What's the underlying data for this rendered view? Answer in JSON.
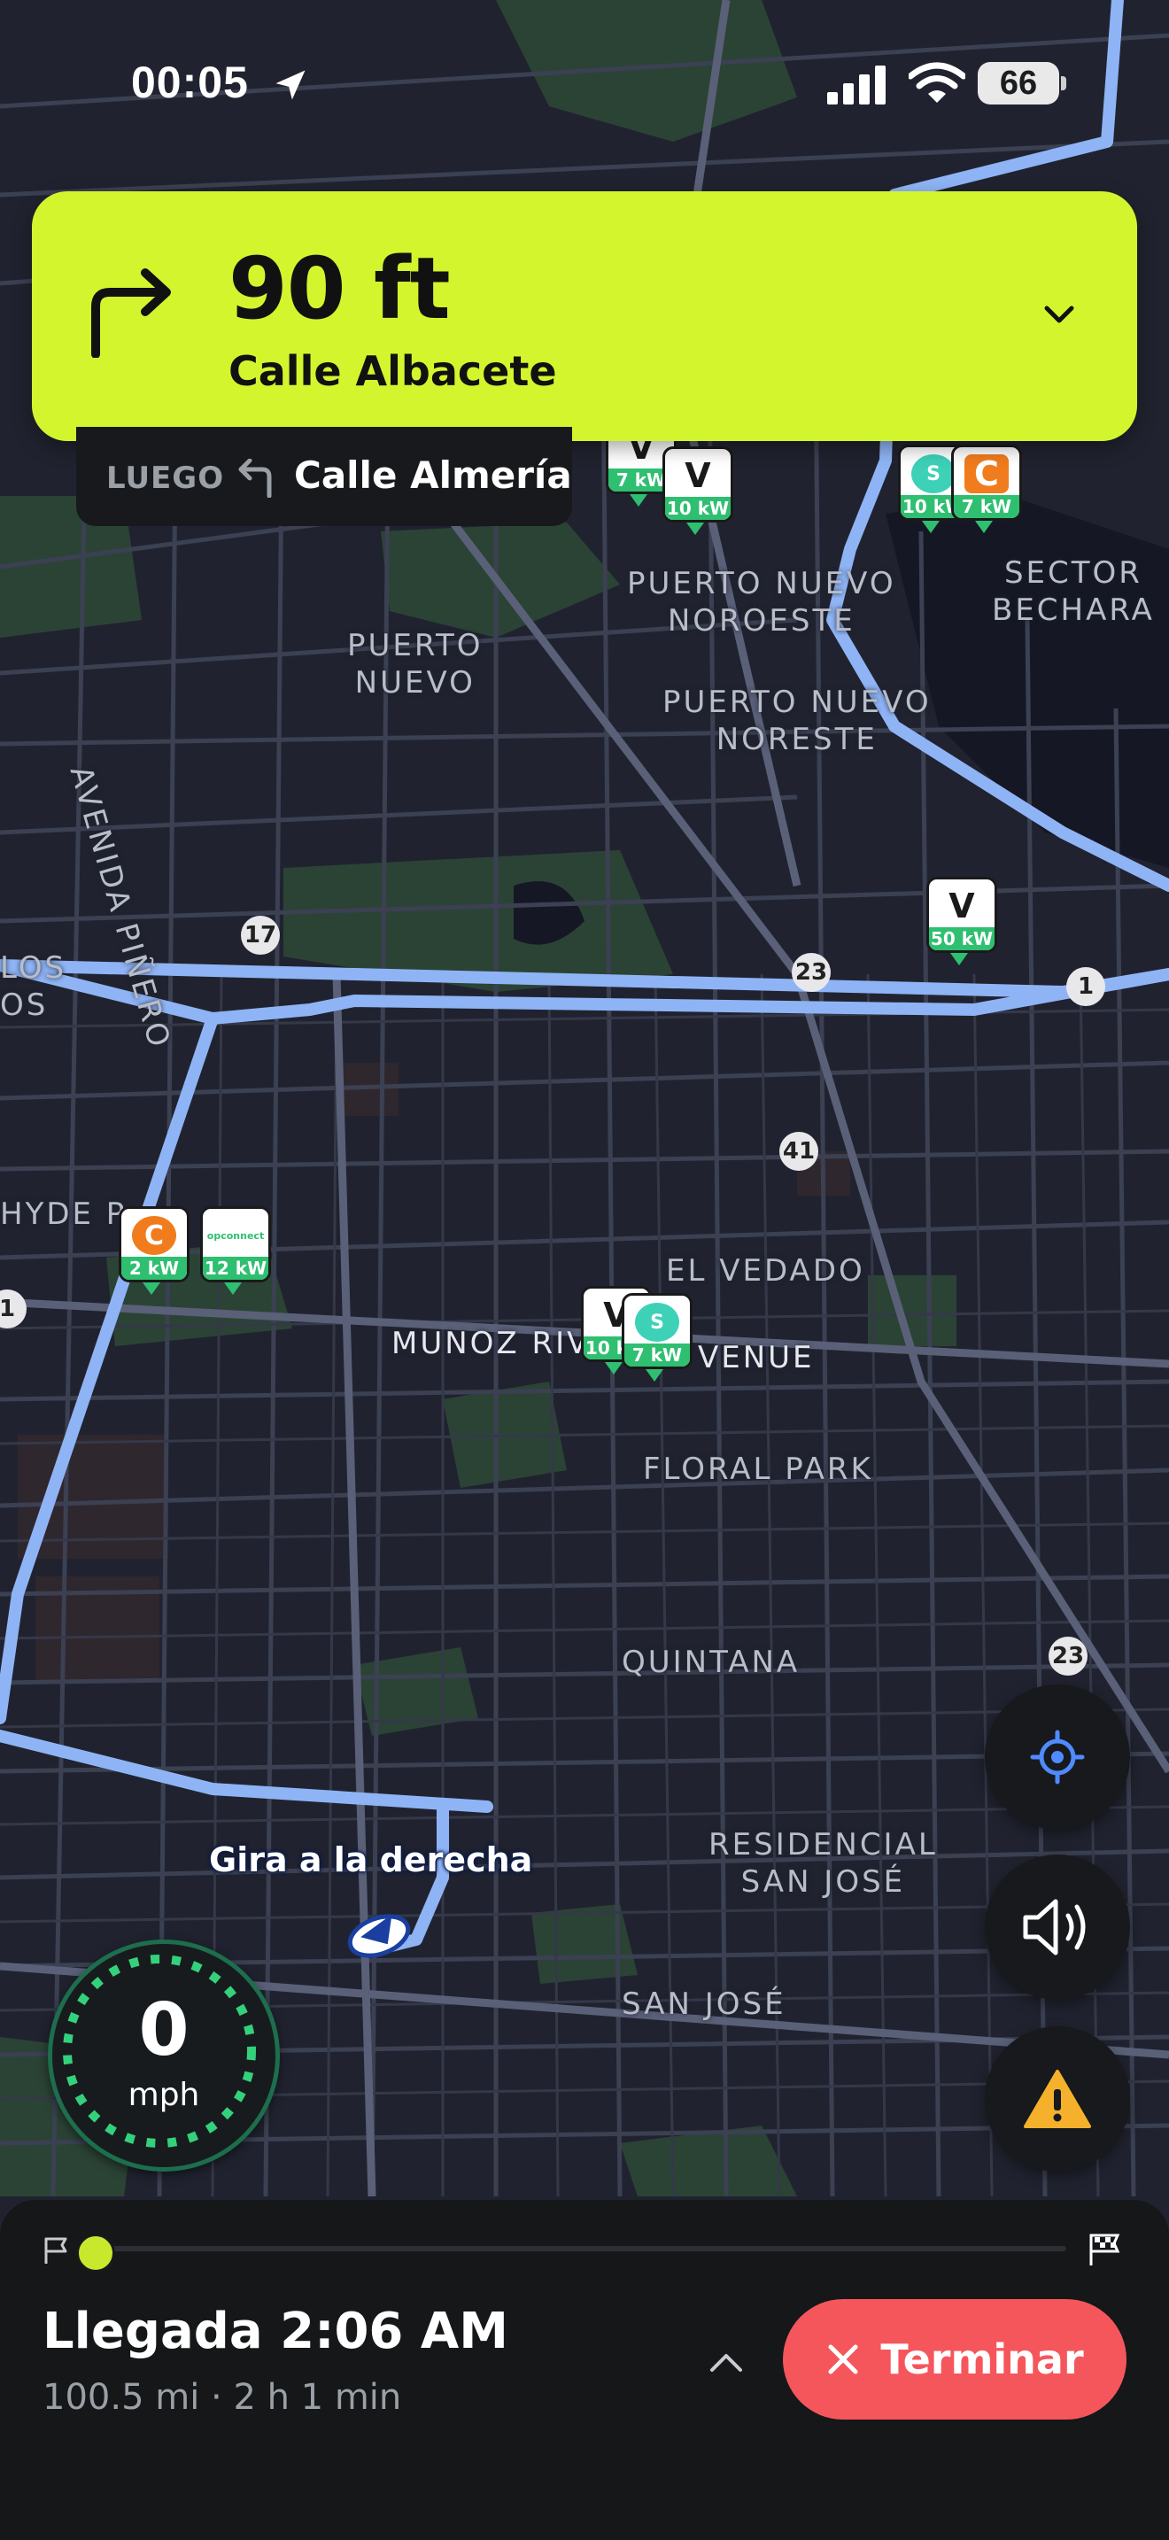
{
  "status_bar": {
    "time": "00:05",
    "battery": "66"
  },
  "nav": {
    "distance": "90 ft",
    "street": "Calle Albacete",
    "then_label": "LUEGO",
    "then_street": "Calle Almería"
  },
  "map_labels": {
    "puerto_nuevo": "PUERTO\nNUEVO",
    "avenida_pinero": "AVENIDA PIÑERO",
    "pn_noroeste": "PUERTO NUEVO\nNOROESTE",
    "pn_noreste": "PUERTO NUEVO\nNORESTE",
    "sector_bechara": "SECTOR\nBECHARA",
    "los": "LOS\nOS",
    "hyde_p": "HYDE P",
    "el_vedado": "EL VEDADO",
    "munoz_rivera": "MUNOZ RIV",
    "avenue": "VENUE",
    "floral_park": "FLORAL PARK",
    "quintana": "QUINTANA",
    "residencial_san_jose": "RESIDENCIAL\nSAN JOSÉ",
    "san_jose": "SAN JOSÉ"
  },
  "road_shields": {
    "r17": "17",
    "r23a": "23",
    "r41": "41",
    "r23b": "23",
    "r1": "1",
    "r_edge": "1"
  },
  "chargers": [
    {
      "brand": "V",
      "kw": "7 kW"
    },
    {
      "brand": "V",
      "kw": "10 kW"
    },
    {
      "brand": "S",
      "kw": "10 kW"
    },
    {
      "brand": "C",
      "kw": "7 kW"
    },
    {
      "brand": "V",
      "kw": "50 kW"
    },
    {
      "brand": "C",
      "kw": "2 kW"
    },
    {
      "brand": "opconnect",
      "kw": "12 kW"
    },
    {
      "brand": "V",
      "kw": "10 kW"
    },
    {
      "brand": "S",
      "kw": "7 kW"
    }
  ],
  "turn_callout": "Gira a la derecha",
  "speed": {
    "value": "0",
    "unit": "mph"
  },
  "trip": {
    "arrival": "Llegada 2:06 AM",
    "summary": "100.5 mi · 2 h 1 min",
    "end_label": "Terminar"
  },
  "colors": {
    "banner": "#d3f52d",
    "route": "#8fb4f5",
    "end_button": "#f5565c",
    "charger_green": "#2fbf71"
  }
}
